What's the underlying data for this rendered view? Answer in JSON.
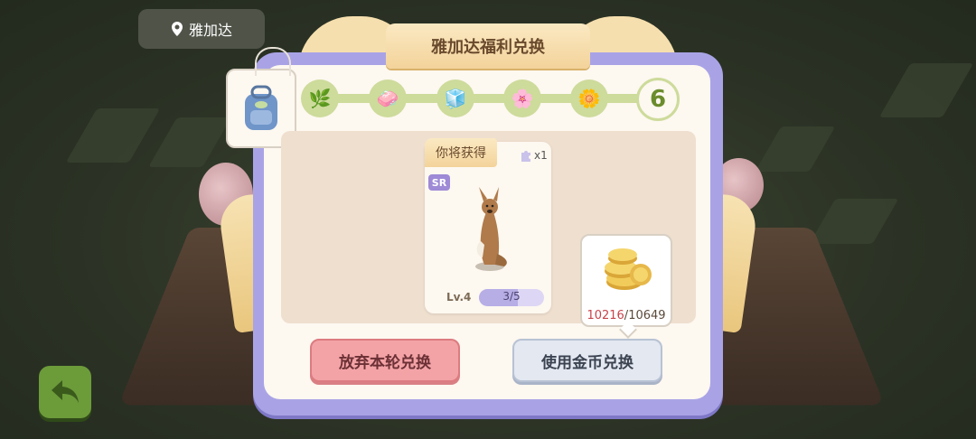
{
  "location": {
    "name": "雅加达",
    "icon": "location-pin-icon"
  },
  "dialog": {
    "title": "雅加达福利兑换",
    "bag_icon": "backpack-icon",
    "progress": {
      "steps": [
        {
          "icon": "plant-icon"
        },
        {
          "icon": "eraser-icon"
        },
        {
          "icon": "ice-block-icon"
        },
        {
          "icon": "purple-flower-icon"
        },
        {
          "icon": "daisy-icon"
        }
      ],
      "final_step": "6"
    },
    "reward": {
      "label": "你将获得",
      "quantity": "x1",
      "rarity": "SR",
      "level": "Lv.4",
      "progress_text": "3/5",
      "progress_fraction": 0.6,
      "image": "kangaroo-card"
    },
    "coins": {
      "have": "10216",
      "separator": "/",
      "need": "10649",
      "icon": "gold-coins-icon"
    },
    "buttons": {
      "abandon": "放弃本轮兑换",
      "use_coins": "使用金币兑换"
    }
  },
  "back_button": {
    "icon": "back-arrow-icon"
  },
  "colors": {
    "dialog_border": "#a9a3e6",
    "progress": "#cddb9b",
    "abandon": "#f3a3a6",
    "coin_have": "#c8434a"
  }
}
